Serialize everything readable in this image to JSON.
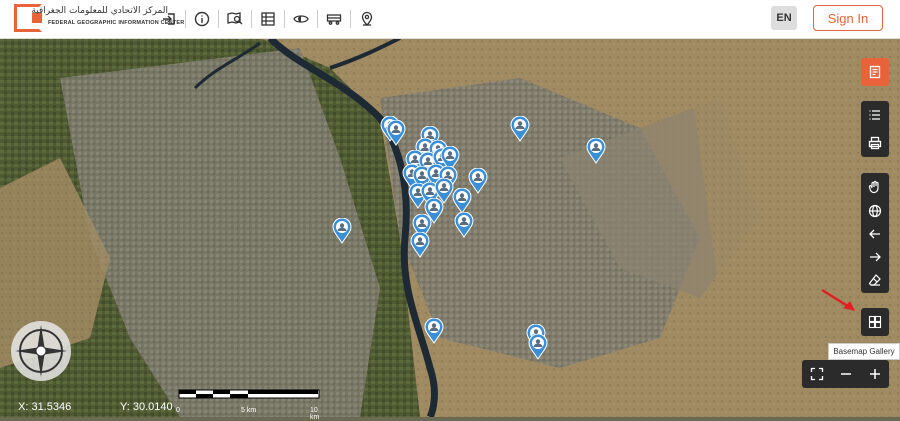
{
  "header": {
    "logo_arabic": "المركز الاتحادي للمعلومات الجغرافية",
    "logo_english": "FEDERAL GEOGRAPHIC INFORMATION CENTER",
    "language_button": "EN",
    "sign_in_button": "Sign In"
  },
  "toolbar": {
    "tools": [
      "login-icon",
      "info-icon",
      "map-search-icon",
      "table-icon",
      "layers-eye-icon",
      "bus-icon",
      "location-pin-icon"
    ]
  },
  "right_panel": {
    "buttons": [
      "report-icon",
      "list-icon",
      "print-icon",
      "pan-hand-icon",
      "globe-icon",
      "back-arrow-icon",
      "forward-arrow-icon",
      "eraser-icon",
      "basemap-gallery-icon"
    ],
    "tooltip": "Basemap Gallery"
  },
  "zoom": {
    "buttons": [
      "fullscreen-icon",
      "zoom-out-icon",
      "zoom-in-icon"
    ]
  },
  "status": {
    "x_label": "X: 31.5346",
    "y_label": "Y: 30.0140"
  },
  "scale": {
    "labels": [
      "0",
      "5 km",
      "10 km"
    ]
  },
  "colors": {
    "accent": "#e8623a",
    "pin": "#3a8fd6",
    "control_bg": "#2b2b2b"
  }
}
